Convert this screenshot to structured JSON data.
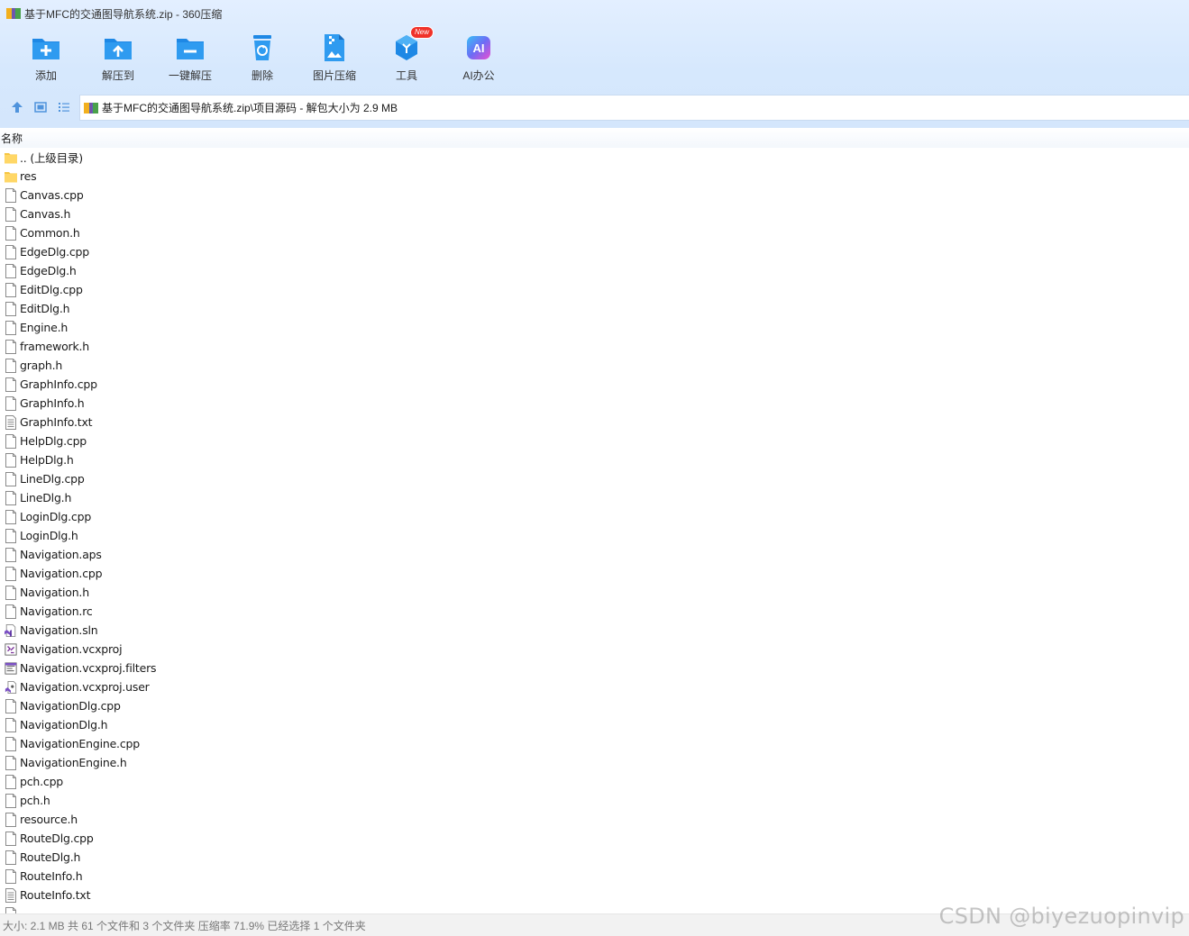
{
  "window": {
    "title": "基于MFC的交通图导航系统.zip - 360压缩"
  },
  "toolbar": [
    {
      "label": "添加",
      "icon": "add-folder-icon"
    },
    {
      "label": "解压到",
      "icon": "extract-to-icon"
    },
    {
      "label": "一键解压",
      "icon": "one-click-extract-icon"
    },
    {
      "label": "删除",
      "icon": "delete-icon"
    },
    {
      "label": "图片压缩",
      "icon": "image-compress-icon"
    },
    {
      "label": "工具",
      "icon": "tools-icon",
      "badge": "New"
    },
    {
      "label": "AI办公",
      "icon": "ai-office-icon"
    }
  ],
  "address": {
    "path": "基于MFC的交通图导航系统.zip\\项目源码 - 解包大小为 2.9 MB"
  },
  "list": {
    "column_name": "名称",
    "items": [
      {
        "name": ".. (上级目录)",
        "type": "folder"
      },
      {
        "name": "res",
        "type": "folder"
      },
      {
        "name": "Canvas.cpp",
        "type": "file"
      },
      {
        "name": "Canvas.h",
        "type": "file"
      },
      {
        "name": "Common.h",
        "type": "file"
      },
      {
        "name": "EdgeDlg.cpp",
        "type": "file"
      },
      {
        "name": "EdgeDlg.h",
        "type": "file"
      },
      {
        "name": "EditDlg.cpp",
        "type": "file"
      },
      {
        "name": "EditDlg.h",
        "type": "file"
      },
      {
        "name": "Engine.h",
        "type": "file"
      },
      {
        "name": "framework.h",
        "type": "file"
      },
      {
        "name": "graph.h",
        "type": "file"
      },
      {
        "name": "GraphInfo.cpp",
        "type": "file"
      },
      {
        "name": "GraphInfo.h",
        "type": "file"
      },
      {
        "name": "GraphInfo.txt",
        "type": "text"
      },
      {
        "name": "HelpDlg.cpp",
        "type": "file"
      },
      {
        "name": "HelpDlg.h",
        "type": "file"
      },
      {
        "name": "LineDlg.cpp",
        "type": "file"
      },
      {
        "name": "LineDlg.h",
        "type": "file"
      },
      {
        "name": "LoginDlg.cpp",
        "type": "file"
      },
      {
        "name": "LoginDlg.h",
        "type": "file"
      },
      {
        "name": "Navigation.aps",
        "type": "file"
      },
      {
        "name": "Navigation.cpp",
        "type": "file"
      },
      {
        "name": "Navigation.h",
        "type": "file"
      },
      {
        "name": "Navigation.rc",
        "type": "file"
      },
      {
        "name": "Navigation.sln",
        "type": "sln"
      },
      {
        "name": "Navigation.vcxproj",
        "type": "vcxproj"
      },
      {
        "name": "Navigation.vcxproj.filters",
        "type": "filters"
      },
      {
        "name": "Navigation.vcxproj.user",
        "type": "user"
      },
      {
        "name": "NavigationDlg.cpp",
        "type": "file"
      },
      {
        "name": "NavigationDlg.h",
        "type": "file"
      },
      {
        "name": "NavigationEngine.cpp",
        "type": "file"
      },
      {
        "name": "NavigationEngine.h",
        "type": "file"
      },
      {
        "name": "pch.cpp",
        "type": "file"
      },
      {
        "name": "pch.h",
        "type": "file"
      },
      {
        "name": "resource.h",
        "type": "file"
      },
      {
        "name": "RouteDlg.cpp",
        "type": "file"
      },
      {
        "name": "RouteDlg.h",
        "type": "file"
      },
      {
        "name": "RouteInfo.h",
        "type": "file"
      },
      {
        "name": "RouteInfo.txt",
        "type": "text"
      },
      {
        "name": "",
        "type": "file"
      }
    ]
  },
  "status": {
    "text": "大小: 2.1 MB 共 61 个文件和 3 个文件夹 压缩率 71.9% 已经选择 1 个文件夹"
  },
  "watermark": "CSDN @biyezuopinvip"
}
